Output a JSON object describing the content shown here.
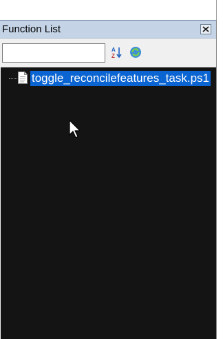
{
  "panel": {
    "title": "Function List"
  },
  "toolbar": {
    "search": {
      "value": "",
      "placeholder": ""
    },
    "sort_icon": "sort-az-icon",
    "refresh_icon": "refresh-icon"
  },
  "tree": {
    "items": [
      {
        "label": "toggle_reconcilefeatures_task.ps1",
        "icon": "file-icon",
        "selected": true
      }
    ]
  },
  "colors": {
    "title_bar": "#c4d4e6",
    "list_background": "#141414",
    "selection": "#0a64d2"
  }
}
